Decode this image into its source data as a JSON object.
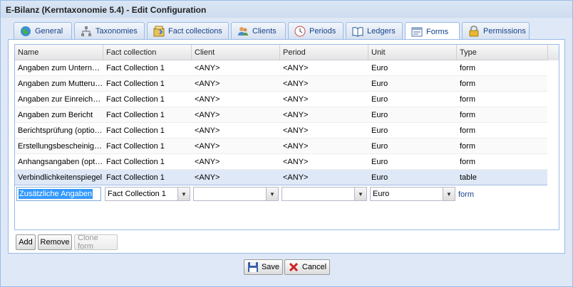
{
  "window": {
    "title": "E-Bilanz (Kerntaxonomie 5.4) - Edit Configuration"
  },
  "tabs": [
    {
      "label": "General",
      "icon": "globe-icon"
    },
    {
      "label": "Taxonomies",
      "icon": "tree-icon"
    },
    {
      "label": "Fact collections",
      "icon": "collection-icon"
    },
    {
      "label": "Clients",
      "icon": "users-icon"
    },
    {
      "label": "Periods",
      "icon": "clock-icon"
    },
    {
      "label": "Ledgers",
      "icon": "book-icon"
    },
    {
      "label": "Forms",
      "icon": "form-icon",
      "active": true
    },
    {
      "label": "Permissions",
      "icon": "lock-icon"
    }
  ],
  "grid": {
    "columns": [
      "Name",
      "Fact collection",
      "Client",
      "Period",
      "Unit",
      "Type"
    ],
    "rows": [
      [
        "Angaben zum Unternehmen",
        "Fact Collection 1",
        "<ANY>",
        "<ANY>",
        "Euro",
        "form"
      ],
      [
        "Angaben zum Mutterunternehmen",
        "Fact Collection 1",
        "<ANY>",
        "<ANY>",
        "Euro",
        "form"
      ],
      [
        "Angaben zur Einreichung",
        "Fact Collection 1",
        "<ANY>",
        "<ANY>",
        "Euro",
        "form"
      ],
      [
        "Angaben zum Bericht",
        "Fact Collection 1",
        "<ANY>",
        "<ANY>",
        "Euro",
        "form"
      ],
      [
        "Berichtsprüfung (optional)",
        "Fact Collection 1",
        "<ANY>",
        "<ANY>",
        "Euro",
        "form"
      ],
      [
        "Erstellungsbescheinigung",
        "Fact Collection 1",
        "<ANY>",
        "<ANY>",
        "Euro",
        "form"
      ],
      [
        "Anhangsangaben (optional)",
        "Fact Collection 1",
        "<ANY>",
        "<ANY>",
        "Euro",
        "form"
      ],
      [
        "Verbindlichkeitenspiegel",
        "Fact Collection 1",
        "<ANY>",
        "<ANY>",
        "Euro",
        "table"
      ]
    ],
    "selected_row": 7,
    "edit_row": {
      "name": "Zusätzliche Angaben",
      "fact_collection": "Fact Collection 1",
      "client": "",
      "period": "",
      "unit": "Euro",
      "type": "form"
    }
  },
  "buttons": {
    "add": "Add",
    "remove": "Remove",
    "clone": "Clone form",
    "save": "Save",
    "cancel": "Cancel"
  },
  "colors": {
    "accent": "#15428b",
    "border": "#99bbe8",
    "selected_row": "#dfe8f6"
  }
}
